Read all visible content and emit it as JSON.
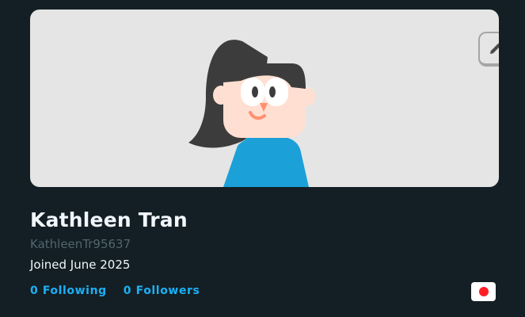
{
  "profile": {
    "name": "Kathleen Tran",
    "username": "KathleenTr95637",
    "joined": "Joined June 2025",
    "following_label": "0 Following",
    "followers_label": "0 Followers",
    "flag": "japan-flag-icon"
  },
  "banner": {
    "background_color": "#e5e5e5",
    "edit_icon": "pencil-icon"
  },
  "colors": {
    "page_background": "#131f24",
    "link": "#1cb0f6",
    "username": "#52656d",
    "text": "#f1f7fb"
  }
}
